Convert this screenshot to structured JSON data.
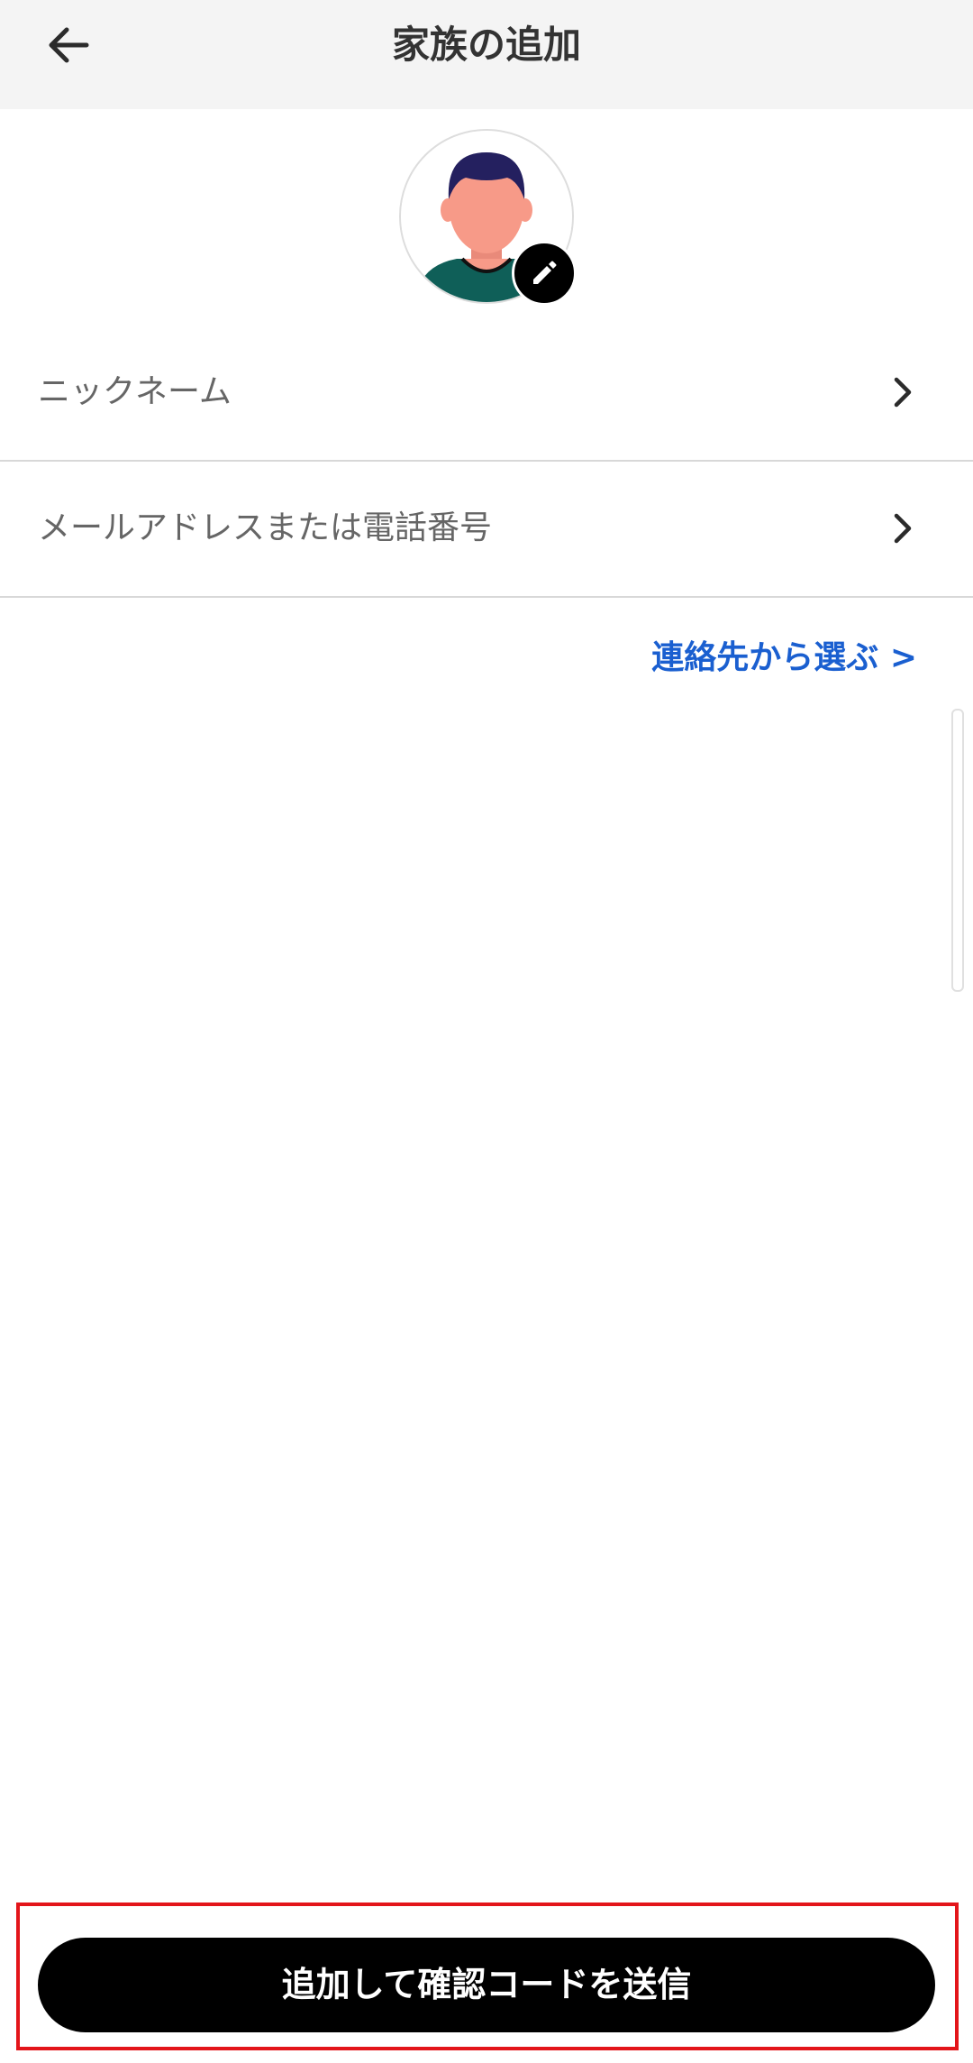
{
  "header": {
    "title": "家族の追加",
    "back_icon": "arrow-left-icon"
  },
  "avatar": {
    "icon": "person-avatar-icon",
    "edit_icon": "pencil-icon"
  },
  "form": {
    "nickname_label": "ニックネーム",
    "contact_label": "メールアドレスまたは電話番号",
    "chevron_icon": "chevron-right-icon"
  },
  "contacts_link": {
    "label": "連絡先から選ぶ >"
  },
  "footer": {
    "submit_label": "追加して確認コードを送信"
  },
  "colors": {
    "header_bg": "#f4f4f4",
    "link": "#1a5fd0",
    "button_bg": "#000000",
    "highlight_border": "#e3151a"
  }
}
